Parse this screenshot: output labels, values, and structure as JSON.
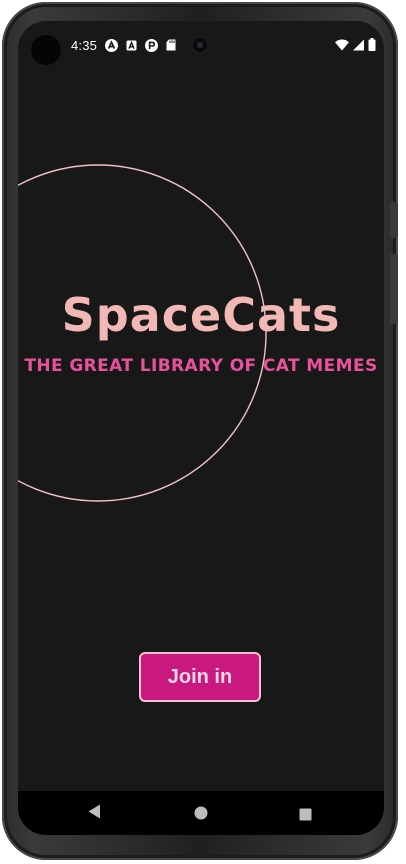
{
  "status_bar": {
    "time": "4:35",
    "notification_icons": [
      "a-circle-icon",
      "a-square-icon",
      "p-circle-icon",
      "sd-card-icon"
    ],
    "system_icons": [
      "wifi-icon",
      "signal-icon",
      "battery-icon"
    ]
  },
  "app": {
    "title": "SpaceCats",
    "subtitle": "THE GREAT LIBRARY OF CAT MEMES",
    "join_button_label": "Join in"
  },
  "navigation_bar": {
    "buttons": [
      "back-icon",
      "home-icon",
      "recents-icon"
    ]
  },
  "colors": {
    "background": "#181818",
    "title": "#f2b8b5",
    "subtitle": "#e8519b",
    "ring": "#f2c2c4",
    "button_fill": "#c9187f",
    "button_border": "#f2c2d4",
    "button_text": "#f6d7e4"
  }
}
